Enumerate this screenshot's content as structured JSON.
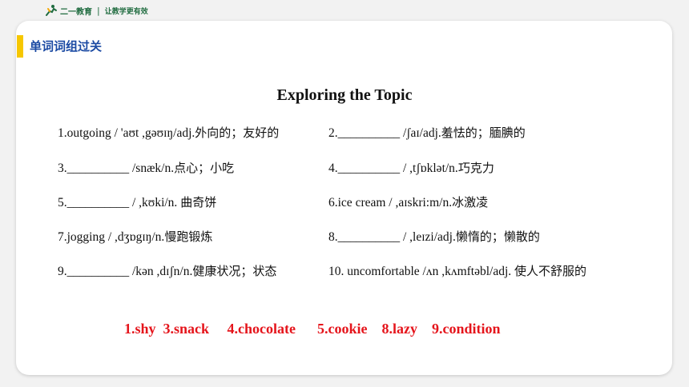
{
  "header": {
    "logo_text": "二一教育",
    "separator": "|",
    "slogan": "让教学更有效"
  },
  "section": {
    "title": "单词词组过关"
  },
  "main": {
    "title": "Exploring the Topic",
    "entries": [
      {
        "en": "1.outgoing / 'aʊt ,gəʊɪŋ/adj.",
        "zh": "外向的；友好的"
      },
      {
        "en": "2.__________ /ʃaɪ/adj.",
        "zh": "羞怯的；腼腆的"
      },
      {
        "en": "3.__________ /snæk/n.",
        "zh": "点心；小吃"
      },
      {
        "en": "4.__________ / ,tʃɒklət/n.",
        "zh": "巧克力"
      },
      {
        "en": "5.__________ / ,kʊki/n. ",
        "zh": "曲奇饼"
      },
      {
        "en": "6.ice cream / ,aɪskri:m/n.",
        "zh": "冰激凌"
      },
      {
        "en": "7.jogging / ,dʒɒgɪŋ/n.",
        "zh": "慢跑锻炼"
      },
      {
        "en": "8.__________ / ,leɪzi/adj.",
        "zh": "懒惰的；懒散的"
      },
      {
        "en": "9.__________ /kən ,dɪʃn/n.",
        "zh": "健康状况；状态"
      },
      {
        "en": "10. uncomfortable /ʌn ,kʌmftəbl/adj. ",
        "zh": "使人不舒服的"
      }
    ],
    "answers": "1.shy  3.snack     4.chocolate      5.cookie    8.lazy    9.condition"
  },
  "colors": {
    "accent_yellow": "#f6c700",
    "section_title_blue": "#1b4aa3",
    "answer_red": "#e5141b",
    "brand_green": "#1f6b3f"
  }
}
